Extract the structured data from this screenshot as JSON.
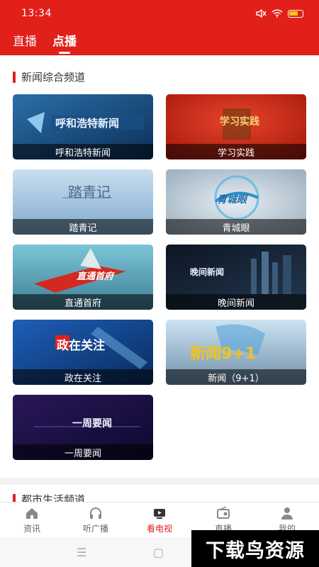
{
  "status_bar": {
    "time": "13:34",
    "icons": [
      "mute-icon",
      "wifi-icon",
      "battery-icon"
    ]
  },
  "header": {
    "tabs": [
      {
        "label": "直播",
        "active": false
      },
      {
        "label": "点播",
        "active": true
      }
    ]
  },
  "sections": [
    {
      "title": "新闻综合频道",
      "cards": [
        {
          "label": "呼和浩特新闻",
          "thumb_text": "呼和浩特新闻"
        },
        {
          "label": "学习实践",
          "thumb_text": "学习实践"
        },
        {
          "label": "踏青记",
          "thumb_text": "踏青记"
        },
        {
          "label": "青城眼",
          "thumb_text": "青城眼"
        },
        {
          "label": "直通首府",
          "thumb_text": "直通首府"
        },
        {
          "label": "晚间新闻",
          "thumb_text": "晚间新闻"
        },
        {
          "label": "政在关注",
          "thumb_text": "政在关注"
        },
        {
          "label": "新闻（9+1）",
          "thumb_text": "新闻9+1"
        },
        {
          "label": "一周要闻",
          "thumb_text": "一周要闻"
        }
      ]
    },
    {
      "title": "都市生活频道"
    }
  ],
  "bottom_nav": [
    {
      "label": "资讯",
      "icon": "home-icon",
      "active": false
    },
    {
      "label": "听广播",
      "icon": "headphones-icon",
      "active": false
    },
    {
      "label": "看电视",
      "icon": "tv-icon",
      "active": true
    },
    {
      "label": "直播",
      "icon": "radio-icon",
      "active": false
    },
    {
      "label": "我的",
      "icon": "user-icon",
      "active": false
    }
  ],
  "watermark": "下载鸟资源",
  "colors": {
    "brand_red": "#e02019"
  }
}
